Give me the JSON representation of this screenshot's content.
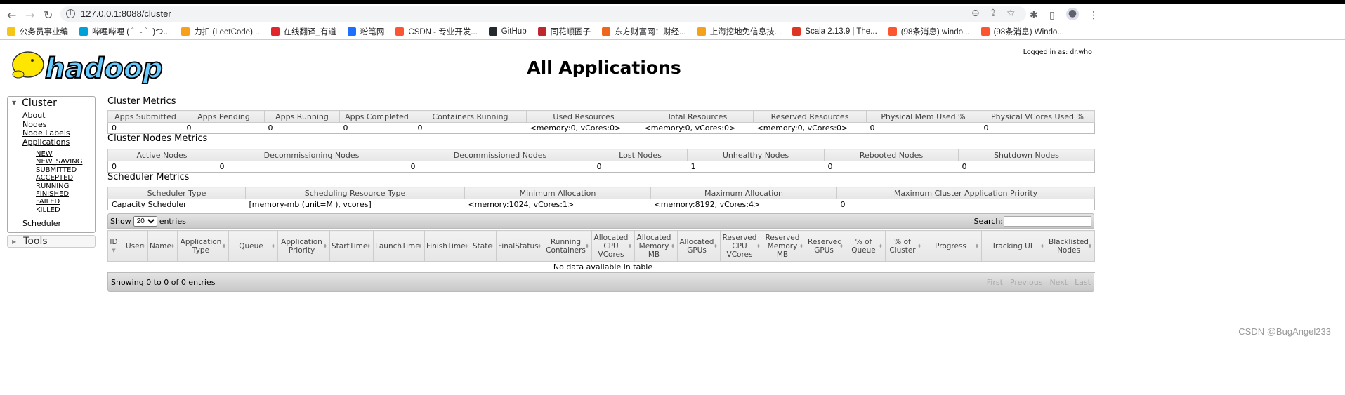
{
  "browser": {
    "url": "127.0.0.1:8088/cluster",
    "bookmarks": [
      {
        "label": "公务员事业编",
        "color": "#f5c518"
      },
      {
        "label": "哔哩哔哩 ( ゜- ゜)つ...",
        "color": "#00a1d6"
      },
      {
        "label": "力扣 (LeetCode)...",
        "color": "#f89f1b"
      },
      {
        "label": "在线翻译_有道",
        "color": "#e0262a"
      },
      {
        "label": "粉笔网",
        "color": "#1e6fff"
      },
      {
        "label": "CSDN - 专业开发...",
        "color": "#fc5531"
      },
      {
        "label": "GitHub",
        "color": "#24292e"
      },
      {
        "label": "同花顺圈子",
        "color": "#c0262d"
      },
      {
        "label": "东方财富网：财经...",
        "color": "#f0641e"
      },
      {
        "label": "上海挖地免信息技...",
        "color": "#f3a21b"
      },
      {
        "label": "Scala 2.13.9 | The...",
        "color": "#de3423"
      },
      {
        "label": "(98条消息) windo...",
        "color": "#fc5531"
      },
      {
        "label": "(98条消息) Windo...",
        "color": "#fc5531"
      }
    ]
  },
  "header": {
    "logo_text": "hadoop",
    "title": "All Applications",
    "logged_in": "Logged in as: dr.who"
  },
  "sidebar": {
    "cluster_label": "Cluster",
    "links": [
      "About",
      "Nodes",
      "Node Labels",
      "Applications"
    ],
    "app_states": [
      "NEW",
      "NEW_SAVING",
      "SUBMITTED",
      "ACCEPTED",
      "RUNNING",
      "FINISHED",
      "FAILED",
      "KILLED"
    ],
    "scheduler": "Scheduler",
    "tools_label": "Tools"
  },
  "cluster_metrics": {
    "title": "Cluster Metrics",
    "headers": [
      "Apps Submitted",
      "Apps Pending",
      "Apps Running",
      "Apps Completed",
      "Containers Running",
      "Used Resources",
      "Total Resources",
      "Reserved Resources",
      "Physical Mem Used %",
      "Physical VCores Used %"
    ],
    "values": [
      "0",
      "0",
      "0",
      "0",
      "0",
      "<memory:0, vCores:0>",
      "<memory:0, vCores:0>",
      "<memory:0, vCores:0>",
      "0",
      "0"
    ]
  },
  "nodes_metrics": {
    "title": "Cluster Nodes Metrics",
    "headers": [
      "Active Nodes",
      "Decommissioning Nodes",
      "Decommissioned Nodes",
      "Lost Nodes",
      "Unhealthy Nodes",
      "Rebooted Nodes",
      "Shutdown Nodes"
    ],
    "values": [
      "0",
      "0",
      "0",
      "0",
      "1",
      "0",
      "0"
    ]
  },
  "scheduler_metrics": {
    "title": "Scheduler Metrics",
    "headers": [
      "Scheduler Type",
      "Scheduling Resource Type",
      "Minimum Allocation",
      "Maximum Allocation",
      "Maximum Cluster Application Priority"
    ],
    "values": [
      "Capacity Scheduler",
      "[memory-mb (unit=Mi), vcores]",
      "<memory:1024, vCores:1>",
      "<memory:8192, vCores:4>",
      "0"
    ]
  },
  "apps_table": {
    "show_label": "Show",
    "entries_value": "20",
    "entries_label": "entries",
    "search_label": "Search:",
    "search_value": "",
    "columns": [
      "ID",
      "User",
      "Name",
      "Application Type",
      "Queue",
      "Application Priority",
      "StartTime",
      "LaunchTime",
      "FinishTime",
      "State",
      "FinalStatus",
      "Running Containers",
      "Allocated CPU VCores",
      "Allocated Memory MB",
      "Allocated GPUs",
      "Reserved CPU VCores",
      "Reserved Memory MB",
      "Reserved GPUs",
      "% of Queue",
      "% of Cluster",
      "Progress",
      "Tracking UI",
      "Blacklisted Nodes"
    ],
    "empty_message": "No data available in table",
    "info": "Showing 0 to 0 of 0 entries",
    "pager": [
      "First",
      "Previous",
      "Next",
      "Last"
    ]
  },
  "watermark": "CSDN @BugAngel233"
}
